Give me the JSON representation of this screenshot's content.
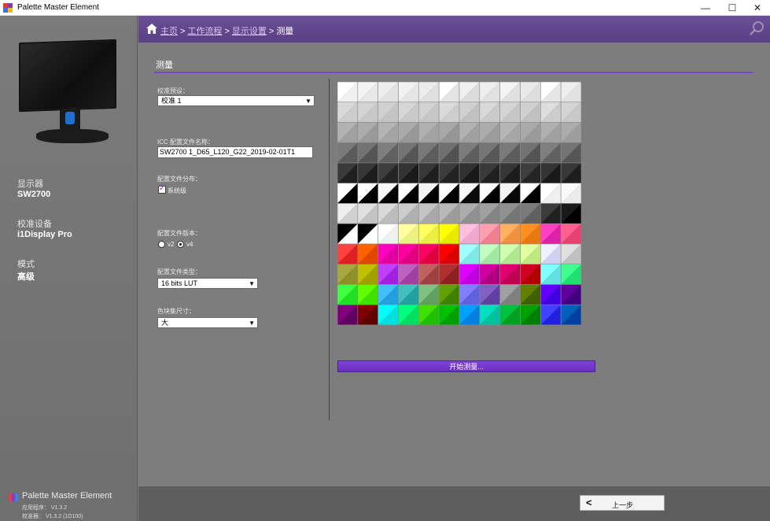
{
  "window": {
    "title": "Palette Master Element",
    "minimize": "—",
    "maximize": "☐",
    "close": "✕"
  },
  "breadcrumb": {
    "items": [
      "主页",
      "工作流程",
      "显示设置"
    ],
    "current": "测量",
    "separator": ">"
  },
  "sidebar": {
    "display_label": "显示器",
    "display_value": "SW2700",
    "device_label": "校准设备",
    "device_value": "i1Display Pro",
    "mode_label": "模式",
    "mode_value": "高级",
    "brand": "Palette Master Element",
    "app_version_label": "应用程序：",
    "app_version": "V1.3.2",
    "engine_version_label": "校准器：",
    "engine_version": "V1.3.2 (1D100)"
  },
  "main": {
    "section_title": "测量",
    "calibration_preset_label": "校准预设：",
    "calibration_preset_value": "校准 1",
    "icc_name_label": "ICC 配置文件名称：",
    "icc_name_value": "SW2700 1_D65_L120_G22_2019-02-01T1",
    "profile_dist_label": "配置文件分布：",
    "system_level_label": "系统级",
    "system_level_checked": true,
    "profile_version_label": "配置文件版本：",
    "v2_label": "v2",
    "v4_label": "v4",
    "profile_version_selected": "v4",
    "profile_type_label": "配置文件类型：",
    "profile_type_value": "16 bits LUT",
    "patch_size_label": "色块集尺寸：",
    "patch_size_value": "大",
    "start_button": "开始测量...",
    "back_button": "上一步"
  },
  "colors": {
    "accent": "#7c45c9",
    "header": "#5e4488"
  },
  "patch_grid": {
    "columns": 12,
    "rows": 12,
    "cells": [
      [
        "#ffffff",
        "#f0f0f0",
        "#f4f4f4",
        "#e8e8e8",
        "#eeeeee",
        "#e2e2e2",
        "#f2f2f2",
        "#e6e6e6",
        "#ececec",
        "#e0e0e0",
        "#ffffff",
        "#e4e4e4",
        "#f0f0f0",
        "#dcdcdc",
        "#eeeeee",
        "#e2e2e2",
        "#f4f4f4",
        "#e0e0e0",
        "#eaeaea",
        "#dedede",
        "#ffffff",
        "#e6e6e6",
        "#eeeeee",
        "#e2e2e2"
      ],
      [
        "#d8d8d8",
        "#cccccc",
        "#d4d4d4",
        "#c8c8c8",
        "#d0d0d0",
        "#c4c4c4",
        "#d6d6d6",
        "#cacaca",
        "#d2d2d2",
        "#c6c6c6",
        "#dadada",
        "#cecece",
        "#d0d0d0",
        "#c2c2c2",
        "#d8d8d8",
        "#cacaca",
        "#d4d4d4",
        "#c6c6c6",
        "#d0d0d0",
        "#c0c0c0",
        "#dddddd",
        "#cccccc",
        "#d4d4d4",
        "#c8c8c8"
      ],
      [
        "#b2b2b2",
        "#a0a0a0",
        "#acacac",
        "#9a9a9a",
        "#b4b4b4",
        "#a4a4a4",
        "#aaaaaa",
        "#989898",
        "#b0b0b0",
        "#a2a2a2",
        "#a8a8a8",
        "#969696",
        "#b2b2b2",
        "#a0a0a0",
        "#acacac",
        "#9c9c9c",
        "#b6b6b6",
        "#a6a6a6",
        "#aaaaaa",
        "#9a9a9a",
        "#b0b0b0",
        "#a0a0a0",
        "#acacac",
        "#9e9e9e"
      ],
      [
        "#7a7a7a",
        "#5a5a5a",
        "#727272",
        "#545454",
        "#7e7e7e",
        "#606060",
        "#747474",
        "#565656",
        "#787878",
        "#5c5c5c",
        "#707070",
        "#525252",
        "#7c7c7c",
        "#5e5e5e",
        "#767676",
        "#585858",
        "#7a7a7a",
        "#5c5c5c",
        "#727272",
        "#545454",
        "#7e7e7e",
        "#606060",
        "#747474",
        "#565656"
      ],
      [
        "#3a3a3a",
        "#202020",
        "#363636",
        "#1c1c1c",
        "#3e3e3e",
        "#242424",
        "#343434",
        "#1a1a1a",
        "#383838",
        "#1e1e1e",
        "#3c3c3c",
        "#222222",
        "#323232",
        "#181818",
        "#3a3a3a",
        "#202020",
        "#363636",
        "#1c1c1c",
        "#3e3e3e",
        "#242424",
        "#343434",
        "#1a1a1a",
        "#383838",
        "#1e1e1e"
      ],
      [
        "#ffffff",
        "#000000",
        "#ffffff",
        "#000000",
        "#f8f8f8",
        "#000000",
        "#ffffff",
        "#000000",
        "#f4f4f4",
        "#000000",
        "#ffffff",
        "#000000",
        "#f8f8f8",
        "#0a0a0a",
        "#ffffff",
        "#000000",
        "#f4f4f4",
        "#080808",
        "#ffffff",
        "#000000",
        "#ffffff",
        "#f0f0f0",
        "#fafafa",
        "#ececec"
      ],
      [
        "#eeeeee",
        "#d0d0d0",
        "#e0e0e0",
        "#c4c4c4",
        "#d8d8d8",
        "#bcbcbc",
        "#cccccc",
        "#b0b0b0",
        "#c4c4c4",
        "#a8a8a8",
        "#b8b8b8",
        "#9c9c9c",
        "#acacac",
        "#909090",
        "#a0a0a0",
        "#848484",
        "#909090",
        "#767676",
        "#7a7a7a",
        "#606060",
        "#3c3c3c",
        "#202020",
        "#1a1a1a",
        "#000000"
      ],
      [
        "#000000",
        "#ffffff",
        "#000000",
        "#ffffff",
        "#ffffff",
        "#f0f0f0",
        "#ffffa0",
        "#f0f080",
        "#ffff60",
        "#eeee40",
        "#ffff00",
        "#e8e800",
        "#ffc0e0",
        "#f0a8d0",
        "#ff9fb0",
        "#f08090",
        "#ffb060",
        "#f09040",
        "#ff9020",
        "#e87810",
        "#ff40c0",
        "#e020a8",
        "#ff6090",
        "#e84070"
      ],
      [
        "#ff4040",
        "#e02020",
        "#ff6000",
        "#e04800",
        "#ff00c0",
        "#e000a0",
        "#ff00a0",
        "#e00080",
        "#ff0060",
        "#e00040",
        "#ff0000",
        "#d80000",
        "#a0ffff",
        "#80e8e8",
        "#c0ffc0",
        "#a0e8a0",
        "#d0ffb0",
        "#b0e890",
        "#e0ffa0",
        "#c0e880",
        "#f0f0ff",
        "#d0d0f0",
        "#e0e0e0",
        "#c0c0c0"
      ],
      [
        "#a8a840",
        "#909028",
        "#c0c000",
        "#a0a000",
        "#c040ff",
        "#a020e0",
        "#c060c0",
        "#a040a0",
        "#c06060",
        "#a04040",
        "#b03030",
        "#902020",
        "#e000ff",
        "#c000e0",
        "#d000a0",
        "#b00080",
        "#e00070",
        "#c00050",
        "#d00020",
        "#b00000",
        "#80ffff",
        "#60e0e0",
        "#40ff90",
        "#20e070"
      ],
      [
        "#40ff40",
        "#20e020",
        "#60ff00",
        "#40e000",
        "#40c0ff",
        "#20a0e0",
        "#40c0c0",
        "#20a0a0",
        "#80c080",
        "#60a060",
        "#60a000",
        "#408000",
        "#8080ff",
        "#6060e0",
        "#8060c0",
        "#6040a0",
        "#a0a0a0",
        "#808080",
        "#608000",
        "#406000",
        "#6000ff",
        "#4000e0",
        "#6000a0",
        "#400080"
      ],
      [
        "#800080",
        "#600060",
        "#800000",
        "#600000",
        "#00ffff",
        "#00e0e0",
        "#00ff80",
        "#00e060",
        "#40e000",
        "#20c000",
        "#00c000",
        "#00a000",
        "#00a0ff",
        "#0080e0",
        "#00e0c0",
        "#00c0a0",
        "#00c040",
        "#00a020",
        "#00a000",
        "#008000",
        "#4040ff",
        "#2020e0",
        "#0060c0",
        "#0040a0"
      ],
      [
        "#006060",
        "#004040",
        "#008000",
        "#006000",
        "#0000ff",
        "#0000e0",
        "#0000c0",
        "#0000a0",
        "#000080",
        "#000060",
        "#7a3cc8",
        "#6a2cb8",
        "#7a3cc8",
        "#6a2cb8",
        "#7a3cc8",
        "#6a2cb8",
        "#7a3cc8",
        "#6a2cb8",
        "#7a3cc8",
        "#6a2cb8",
        "#7a3cc8",
        "#6a2cb8",
        "#7a3cc8",
        "#6a2cb8"
      ]
    ]
  }
}
